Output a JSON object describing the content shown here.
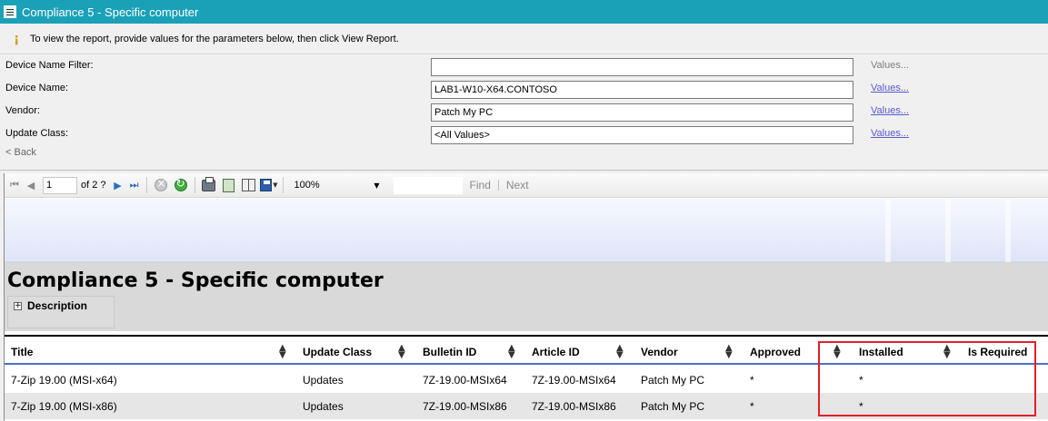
{
  "window": {
    "title": "Compliance 5 - Specific computer"
  },
  "info_bar": {
    "message": "To view the report, provide values for the parameters below, then click View Report."
  },
  "parameters": [
    {
      "label": "Device Name Filter:",
      "value": "",
      "values_link": "Values...",
      "enabled": false
    },
    {
      "label": "Device Name:",
      "value": "LAB1-W10-X64.CONTOSO",
      "values_link": "Values...",
      "enabled": true
    },
    {
      "label": "Vendor:",
      "value": "Patch My PC",
      "values_link": "Values...",
      "enabled": true
    },
    {
      "label": "Update Class:",
      "value": "<All Values>",
      "values_link": "Values...",
      "enabled": true
    }
  ],
  "back_link": "< Back",
  "toolbar": {
    "page_number": "1",
    "page_of": "of 2 ?",
    "zoom": "100%",
    "find_label": "Find",
    "next_label": "Next"
  },
  "report": {
    "title": "Compliance 5 - Specific computer",
    "description_label": "Description"
  },
  "table": {
    "columns": [
      "Title",
      "Update Class",
      "Bulletin ID",
      "Article ID",
      "Vendor",
      "Approved",
      "Installed",
      "Is Required"
    ],
    "rows": [
      [
        "7-Zip 19.00 (MSI-x64)",
        "Updates",
        "7Z-19.00-MSIx64",
        "7Z-19.00-MSIx64",
        "Patch My PC",
        "*",
        "*",
        ""
      ],
      [
        "7-Zip 19.00 (MSI-x86)",
        "Updates",
        "7Z-19.00-MSIx86",
        "7Z-19.00-MSIx86",
        "Patch My PC",
        "*",
        "*",
        ""
      ]
    ]
  },
  "colors": {
    "title_bar": "#1aa1b8",
    "highlight": "#e0202a",
    "header_rule": "#4a6ec8"
  }
}
